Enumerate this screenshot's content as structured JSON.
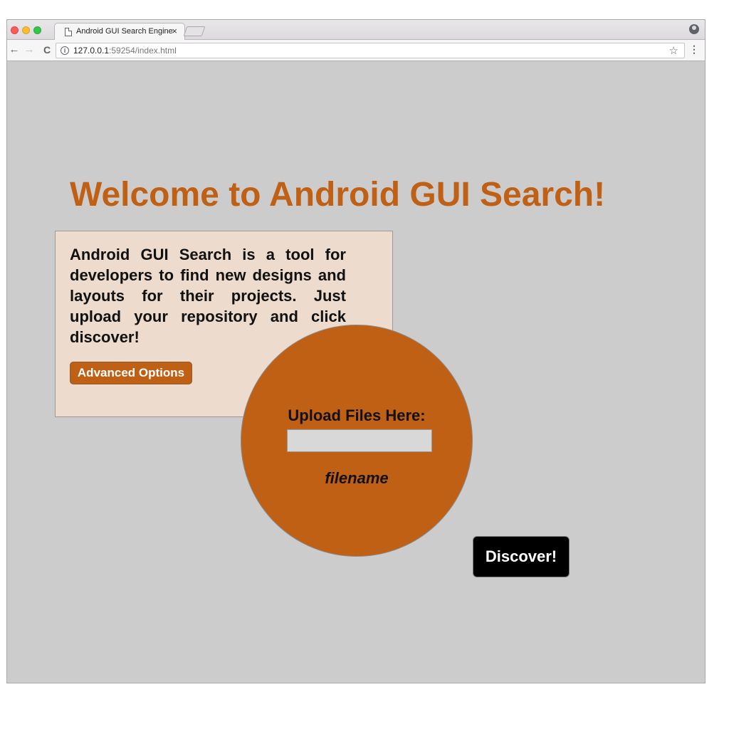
{
  "browser": {
    "tab_title": "Android GUI Search Engine",
    "tab_close": "×",
    "url_host": "127.0.0.1",
    "url_rest": ":59254/index.html",
    "icons": {
      "back": "arrow-left-icon",
      "forward": "arrow-right-icon",
      "reload": "reload-icon",
      "info": "info-icon",
      "star": "star-icon",
      "menu": "kebab-menu-icon",
      "profile": "profile-icon"
    }
  },
  "page": {
    "headline": "Welcome to Android GUI Search!",
    "description": "Android GUI Search is a tool for developers to find new designs and layouts for their projects. Just upload your repository and click discover!",
    "advanced_options_label": "Advanced Options",
    "upload_label": "Upload Files Here:",
    "filename": "filename",
    "discover_label": "Discover!",
    "colors": {
      "accent": "#c06014",
      "background": "#cccccc",
      "info_box": "#eddbcd",
      "discover_button": "#000000"
    }
  }
}
